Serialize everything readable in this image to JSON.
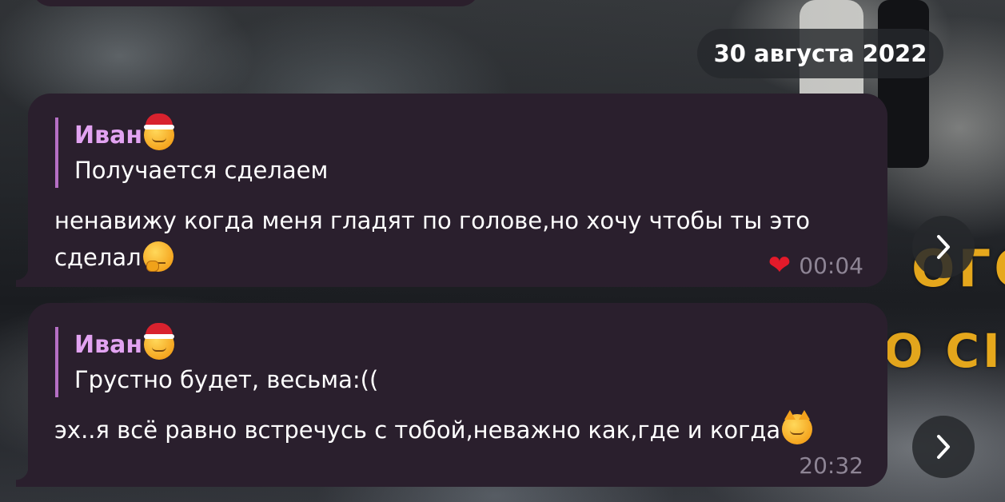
{
  "date_separator": "30 августа 2022",
  "messages": [
    {
      "reply": {
        "author": "Иван",
        "author_icon": "santa-face-emoji",
        "text": "Получается сделаем"
      },
      "text": "ненавижу когда меня гладят по голове,но хочу чтобы ты это сделал",
      "text_emoji": "thinking-face-emoji",
      "reaction": "red-heart",
      "time": "00:04"
    },
    {
      "reply": {
        "author": "Иван",
        "author_icon": "santa-face-emoji",
        "text": "Грустно будет, весьма:(("
      },
      "text": "эх..я всё равно встречусь с тобой,неважно как,где и когда",
      "text_emoji": "smirking-cat-emoji",
      "reaction": null,
      "time": "20:32"
    }
  ],
  "colors": {
    "bubble": "#2a1f2d",
    "reply_bar": "#b56fc4",
    "reply_author": "#e2a3f1",
    "time": "#8e8595",
    "heart": "#e41a2a"
  },
  "actions": {
    "forward_icon": "chevron-right-icon"
  }
}
